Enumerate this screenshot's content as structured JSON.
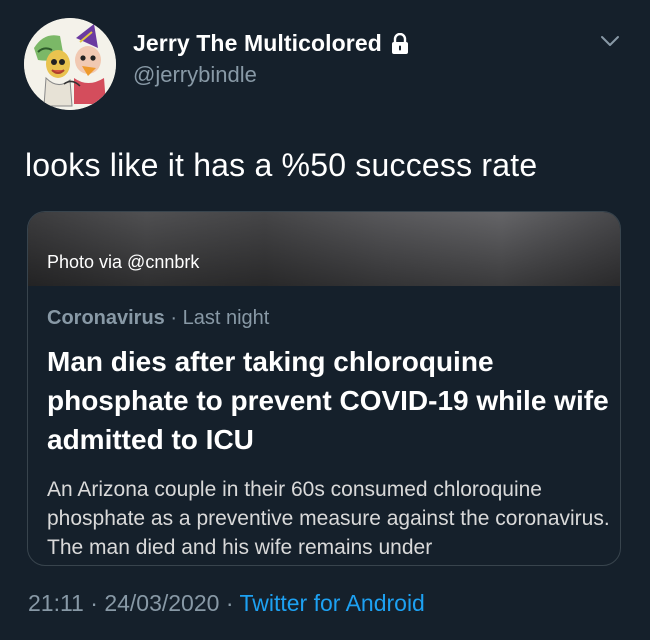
{
  "user": {
    "display_name": "Jerry The Multicolored",
    "handle": "@jerrybindle",
    "avatar_icon": "avatar-illustration",
    "lock_icon": "lock-icon"
  },
  "tweet": {
    "text": "looks like it has a %50 success rate"
  },
  "card": {
    "photo_credit": "Photo via @cnnbrk",
    "category": "Coronavirus",
    "separator": "·",
    "time": "Last night",
    "headline": "Man dies after taking chloroquine phosphate to prevent COVID-19 while wife admitted to ICU",
    "summary": "An Arizona couple in their 60s consumed chloroquine phosphate as a preventive measure against the coronavirus. The man died and his wife remains under"
  },
  "footer": {
    "time": "21:11",
    "sep1": "·",
    "date": "24/03/2020",
    "sep2": "·",
    "source": "Twitter for Android"
  },
  "colors": {
    "background": "#15202b",
    "secondary_text": "#8899a6",
    "link": "#1da1f2",
    "border": "#38444d"
  }
}
